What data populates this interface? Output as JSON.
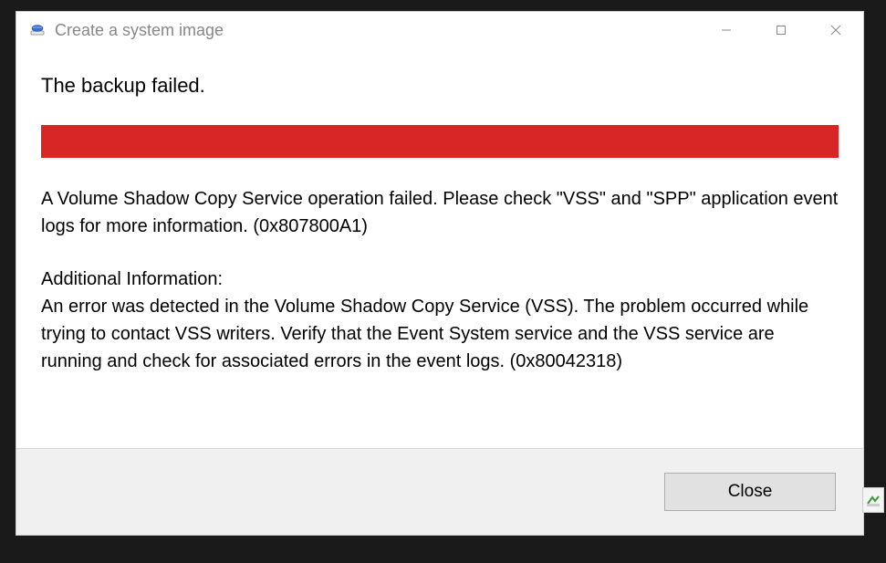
{
  "window": {
    "title": "Create a system image"
  },
  "content": {
    "heading": "The backup failed.",
    "error_message": "A Volume Shadow Copy Service operation failed. Please check \"VSS\" and \"SPP\" application event logs for more information. (0x807800A1)",
    "additional_label": "Additional Information:",
    "additional_text": "An error was detected in the Volume Shadow Copy Service (VSS). The problem occurred while trying to contact VSS writers. Verify that the Event System service and the VSS service are running and check for associated errors in the event logs. (0x80042318)"
  },
  "footer": {
    "close_label": "Close"
  },
  "colors": {
    "error_bar": "#d82626"
  }
}
